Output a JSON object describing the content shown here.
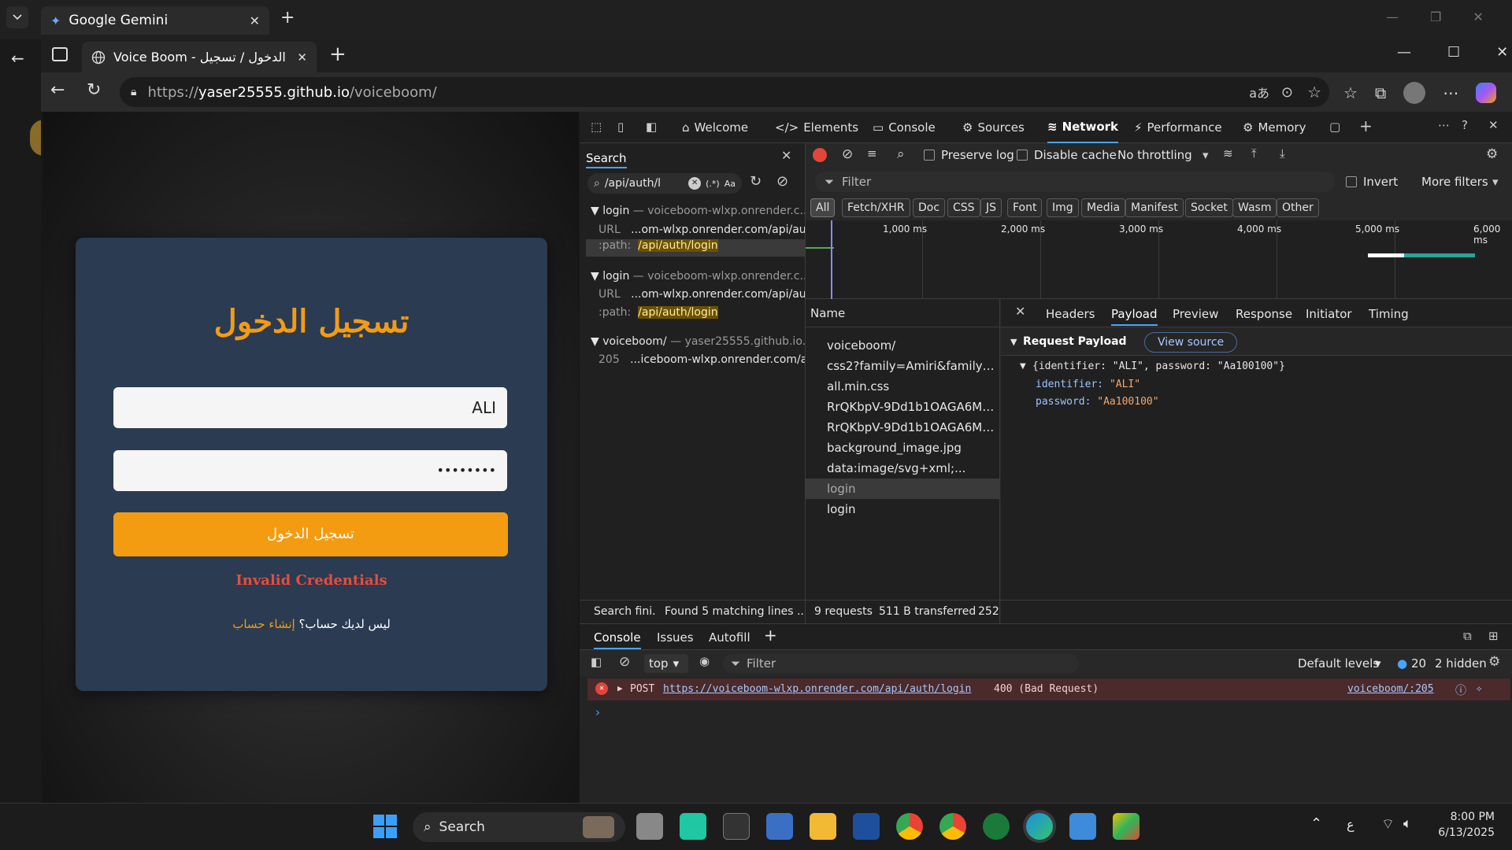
{
  "outer_tab": {
    "title": "Google Gemini"
  },
  "inner_tab": {
    "title": "Voice Boom - تسجيل الدخول / تسجيل"
  },
  "address": {
    "url_prefix": "https://",
    "url_host": "yaser25555.github.io",
    "url_path": "/voiceboom/"
  },
  "login": {
    "title": "تسجيل الدخول",
    "username_value": "ALI",
    "password_value": "••••••••",
    "button_label": "تسجيل الدخول",
    "error_text": "Invalid Credentials",
    "signup_prompt": "ليس لديك حساب؟",
    "signup_link": "إنشاء حساب"
  },
  "devtools": {
    "tabs": [
      "Welcome",
      "Elements",
      "Console",
      "Sources",
      "Network",
      "Performance",
      "Memory"
    ],
    "active_tab": "Network",
    "search": {
      "tab_label": "Search",
      "query": "/api/auth/l",
      "regex_label": "(.*)",
      "case_label": "Aa",
      "results": [
        {
          "name": "login",
          "host": "voiceboom-wlxp.onrender.c...",
          "url_label": "URL",
          "url_value": "...om-wlxp.onrender.com/api/au...",
          "path_label": ":path:",
          "path_value": "/api/auth/login"
        },
        {
          "name": "login",
          "host": "voiceboom-wlxp.onrender.c...",
          "url_label": "URL",
          "url_value": "...om-wlxp.onrender.com/api/au...",
          "path_label": ":path:",
          "path_value": "/api/auth/login"
        },
        {
          "name": "voiceboom/",
          "host": "yaser25555.github.io...",
          "url_label": "205",
          "url_value": "...iceboom-wlxp.onrender.com/a..."
        }
      ],
      "status": "Search fini...",
      "found": "Found 5 matching lines ..."
    },
    "network_toolbar": {
      "preserve_log": "Preserve log",
      "disable_cache": "Disable cache",
      "throttling": "No throttling"
    },
    "filter": {
      "placeholder": "Filter",
      "invert": "Invert",
      "more_filters": "More filters"
    },
    "chips": [
      "All",
      "Fetch/XHR",
      "Doc",
      "CSS",
      "JS",
      "Font",
      "Img",
      "Media",
      "Manifest",
      "Socket",
      "Wasm",
      "Other"
    ],
    "timeline_ticks": [
      "1,000 ms",
      "2,000 ms",
      "3,000 ms",
      "4,000 ms",
      "5,000 ms",
      "6,000 ms"
    ],
    "list_header": "Name",
    "requests": [
      "voiceboom/",
      "css2?family=Amiri&family=Sc...",
      "all.min.css",
      "RrQKbpV-9Dd1b1OAGA6M9P...",
      "RrQKbpV-9Dd1b1OAGA6M9P...",
      "background_image.jpg",
      "data:image/svg+xml;...",
      "login",
      "login"
    ],
    "selected_request": "login",
    "detail_tabs": [
      "Headers",
      "Payload",
      "Preview",
      "Response",
      "Initiator",
      "Timing"
    ],
    "active_detail_tab": "Payload",
    "payload": {
      "section": "Request Payload",
      "view_source": "View source",
      "summary": "{identifier: \"ALI\", password: \"Aa100100\"}",
      "fields": [
        {
          "key": "identifier",
          "value": "\"ALI\""
        },
        {
          "key": "password",
          "value": "\"Aa100100\""
        }
      ]
    },
    "status": {
      "requests": "9 requests",
      "transferred": "511 B transferred",
      "extra": "252"
    },
    "console": {
      "tabs": [
        "Console",
        "Issues",
        "Autofill"
      ],
      "context": "top",
      "filter": "Filter",
      "levels": "Default levels",
      "count": "20",
      "hidden": "2 hidden",
      "error": {
        "method": "POST",
        "url": "https://voiceboom-wlxp.onrender.com/api/auth/login",
        "status": "400 (Bad Request)",
        "source": "voiceboom/:205"
      }
    }
  },
  "taskbar": {
    "search_label": "Search",
    "lang": "ع",
    "time": "8:00 PM",
    "date": "6/13/2025"
  }
}
